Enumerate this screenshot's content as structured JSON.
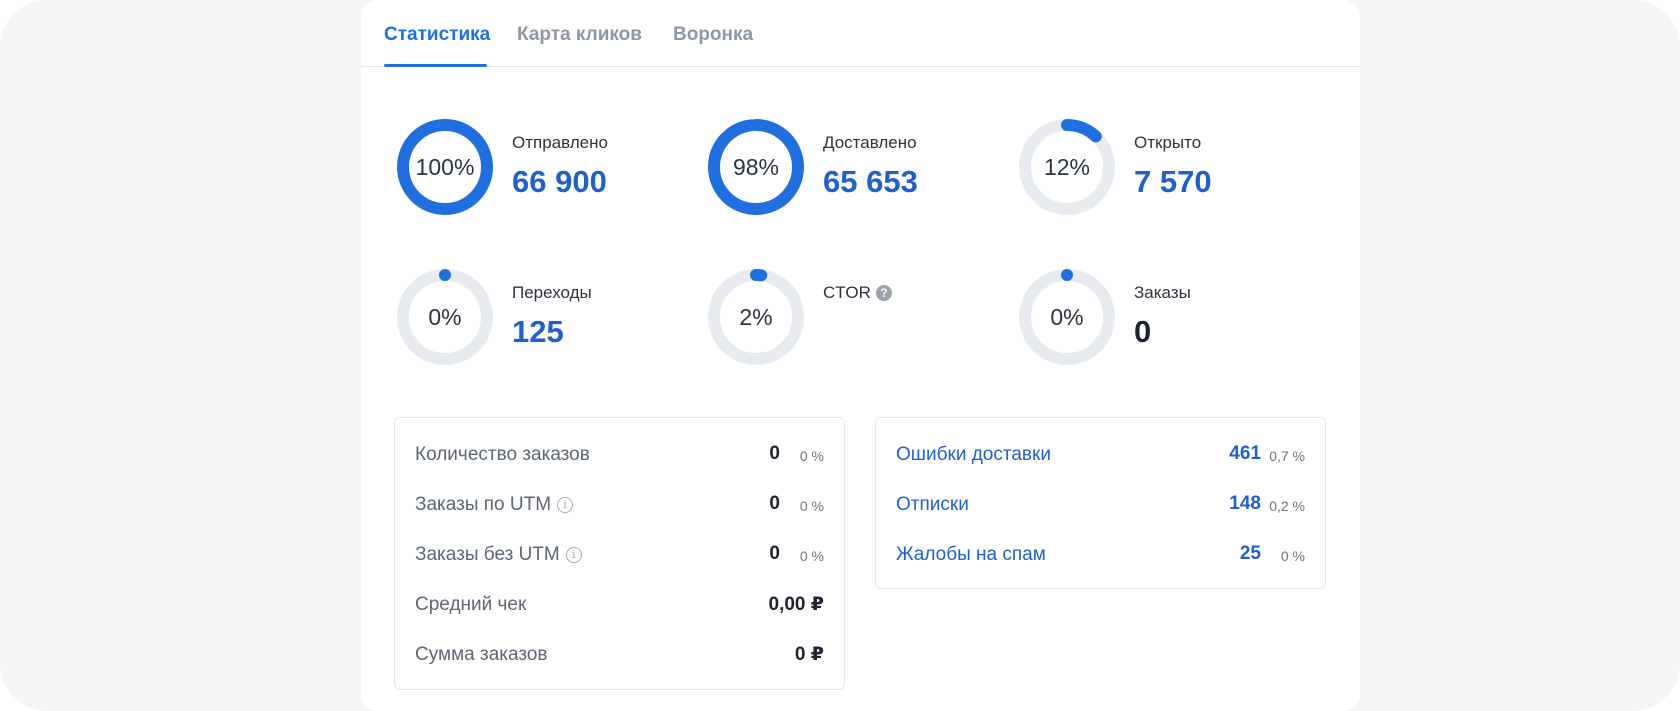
{
  "tabs": [
    {
      "label": "Статистика",
      "active": true
    },
    {
      "label": "Карта кликов",
      "active": false
    },
    {
      "label": "Воронка",
      "active": false
    }
  ],
  "metrics": [
    {
      "label": "Отправлено",
      "percent_text": "100%",
      "fill": 1.0,
      "value": "66 900"
    },
    {
      "label": "Доставлено",
      "percent_text": "98%",
      "fill": 0.98,
      "value": "65 653"
    },
    {
      "label": "Открыто",
      "percent_text": "12%",
      "fill": 0.12,
      "value": "7 570"
    },
    {
      "label": "Переходы",
      "percent_text": "0%",
      "fill": 0.0,
      "value": "125"
    },
    {
      "label": "CTOR",
      "percent_text": "2%",
      "fill": 0.02,
      "value": "",
      "help_icon": "question-circle-icon"
    },
    {
      "label": "Заказы",
      "percent_text": "0%",
      "fill": 0.0,
      "value": "0"
    }
  ],
  "orders_panel": {
    "rows": [
      {
        "label": "Количество заказов",
        "value": "0",
        "pct": "0 %"
      },
      {
        "label": "Заказы по UTM",
        "value": "0",
        "pct": "0 %",
        "info_icon": "info-circle-icon"
      },
      {
        "label": "Заказы без UTM",
        "value": "0",
        "pct": "0 %",
        "info_icon": "info-circle-icon"
      },
      {
        "label": "Средний чек",
        "value": "0,00 ₽"
      },
      {
        "label": "Сумма заказов",
        "value": "0 ₽"
      }
    ]
  },
  "issues_panel": {
    "rows": [
      {
        "label": "Ошибки доставки",
        "value": "461",
        "pct": "0,7 %"
      },
      {
        "label": "Отписки",
        "value": "148",
        "pct": "0,2 %"
      },
      {
        "label": "Жалобы на спам",
        "value": "25",
        "pct": "0 %"
      }
    ]
  },
  "colors": {
    "accent": "#1f6fe0",
    "value_blue": "#1f5fcf",
    "ring_track": "#e8ebef",
    "background": "#f4f5f7"
  }
}
